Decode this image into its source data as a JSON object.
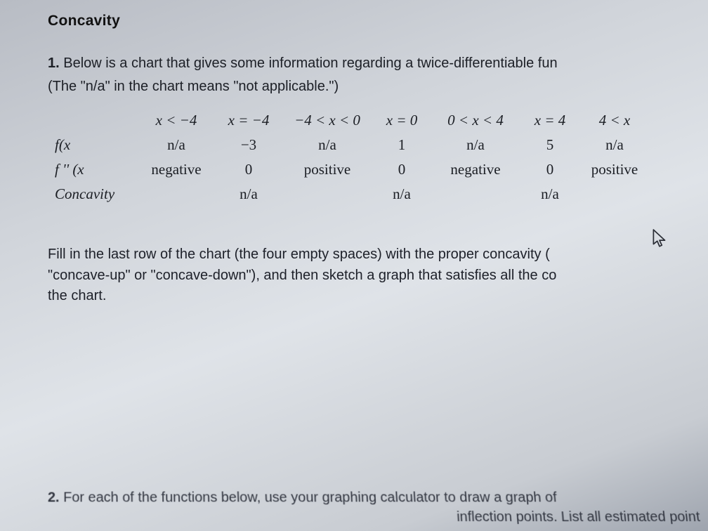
{
  "heading": "Concavity",
  "problem1": {
    "number": "1.",
    "line1": "Below is a chart that gives some information regarding a twice-differentiable fun",
    "line2": "(The \"n/a\" in the chart means \"not applicable.\")"
  },
  "table": {
    "colheaders": [
      "x < −4",
      "x = −4",
      "−4 < x < 0",
      "x = 0",
      "0 < x < 4",
      "x = 4",
      "4 < x"
    ],
    "rows": [
      {
        "label": "f(x",
        "cells": [
          "n/a",
          "−3",
          "n/a",
          "1",
          "n/a",
          "5",
          "n/a"
        ]
      },
      {
        "label": "f '' (x",
        "cells": [
          "negative",
          "0",
          "positive",
          "0",
          "negative",
          "0",
          "positive"
        ]
      },
      {
        "label": "Concavity",
        "cells": [
          "",
          "n/a",
          "",
          "n/a",
          "",
          "n/a",
          ""
        ]
      }
    ]
  },
  "instructions": {
    "line1": "Fill in the last row of the chart (the four empty spaces) with the proper concavity (",
    "line2": "\"concave-up\" or \"concave-down\"), and then sketch a graph that satisfies all the co",
    "line3": "the chart."
  },
  "problem2": {
    "number": "2.",
    "line1": "For each of the functions below, use your graphing calculator to draw a graph of",
    "line2": "inflection points.  List all estimated point"
  }
}
